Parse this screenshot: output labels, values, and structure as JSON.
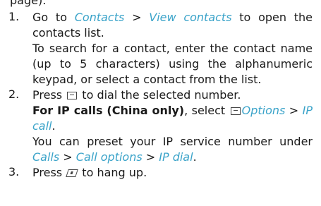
{
  "fragment_top": "page).",
  "steps": [
    {
      "number": "1.",
      "paragraphs": [
        {
          "parts": [
            "Go to ",
            "Contacts",
            " > ",
            "View contacts",
            " to open the contacts list."
          ]
        },
        {
          "text": "To search for a contact, enter the contact name (up to 5 characters) using the alphanumeric keypad, or select a contact from the list."
        }
      ]
    },
    {
      "number": "2.",
      "paragraphs": [
        {
          "parts": [
            "Press ",
            "dial-key",
            " to dial the selected number."
          ]
        },
        {
          "parts": [
            "For IP calls (China only)",
            ", select ",
            "options-key",
            "Options",
            " > ",
            "IP call",
            "."
          ]
        },
        {
          "parts": [
            "You can preset your IP service number under ",
            "Calls",
            " > ",
            "Call options",
            " > ",
            "IP dial",
            "."
          ]
        }
      ]
    },
    {
      "number": "3.",
      "paragraphs": [
        {
          "parts": [
            "Press ",
            "end-key",
            " to hang up."
          ]
        }
      ]
    }
  ]
}
